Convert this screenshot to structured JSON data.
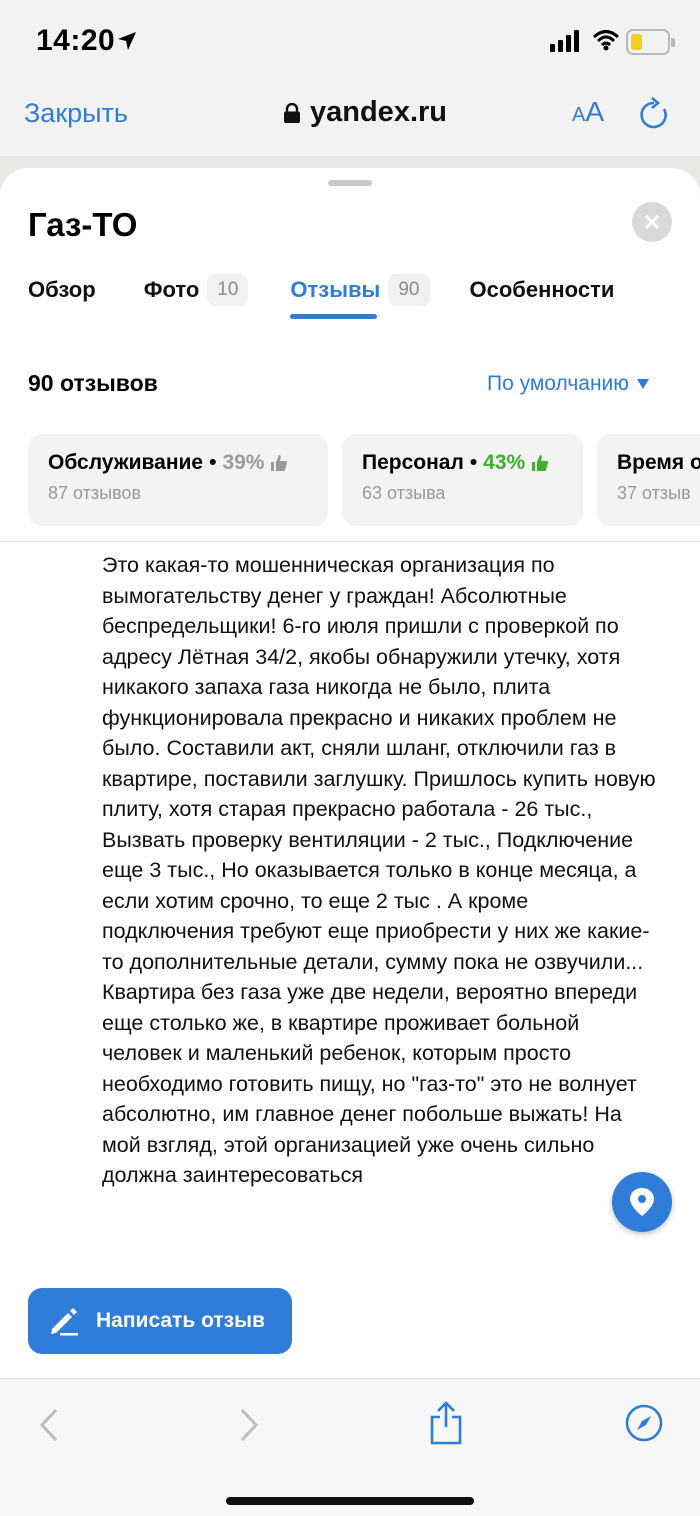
{
  "status_bar": {
    "time": "14:20"
  },
  "browser": {
    "close_label": "Закрыть",
    "url": "yandex.ru",
    "text_size_label_small": "A",
    "text_size_label_large": "A"
  },
  "place": {
    "title": "Газ-ТО",
    "tabs": [
      {
        "label": "Обзор",
        "count": ""
      },
      {
        "label": "Фото",
        "count": "10"
      },
      {
        "label": "Отзывы",
        "count": "90"
      },
      {
        "label": "Особенности",
        "count": ""
      }
    ],
    "active_tab": "Отзывы"
  },
  "reviews": {
    "count_title": "90 отзывов",
    "sort_label": "По умолчанию",
    "aspects": [
      {
        "name": "Обслуживание",
        "percent": "39%",
        "reviews": "87 отзывов",
        "sentiment": "neutral"
      },
      {
        "name": "Персонал",
        "percent": "43%",
        "reviews": "63 отзыва",
        "sentiment": "positive"
      },
      {
        "name": "Время о",
        "percent": "",
        "reviews": "37 отзыв",
        "sentiment": ""
      }
    ],
    "review_text": "Это какая-то мошенническая организация по вымогательству денег у граждан! Абсолютные беспредельщики! 6-го июля пришли с проверкой по адресу Лётная 34/2, якобы обнаружили утечку, хотя никакого запаха газа никогда не было, плита функционировала прекрасно и никаких проблем не было. Составили акт, сняли шланг, отключили газ в квартире, поставили заглушку. Пришлось купить новую плиту, хотя старая прекрасно работала - 26 тыс., Вызвать проверку вентиляции - 2 тыс., Подключение еще 3 тыс., Но оказывается только в конце месяца, а если хотим срочно, то еще 2 тыс . А кроме подключения требуют еще приобрести у них же какие-то дополнительные детали, сумму пока не озвучили... Квартира без газа уже две недели, вероятно впереди еще столько же, в квартире проживает больной человек и маленький ребенок, которым просто необходимо готовить пищу, но \"газ-то\" это не волнует абсолютно, им главное денег побольше выжать! На мой взгляд, этой организацией уже очень сильно должна заинтересоваться",
    "write_button": "Написать отзыв"
  },
  "colors": {
    "accent": "#2f7dd8",
    "positive": "#3db12b",
    "neutral": "#9a9a9a"
  },
  "icons": {
    "back": "chevron-left-icon",
    "forward": "chevron-right-icon",
    "share": "share-icon",
    "compass": "compass-icon",
    "location": "location-pin-icon",
    "pencil": "pencil-icon"
  }
}
